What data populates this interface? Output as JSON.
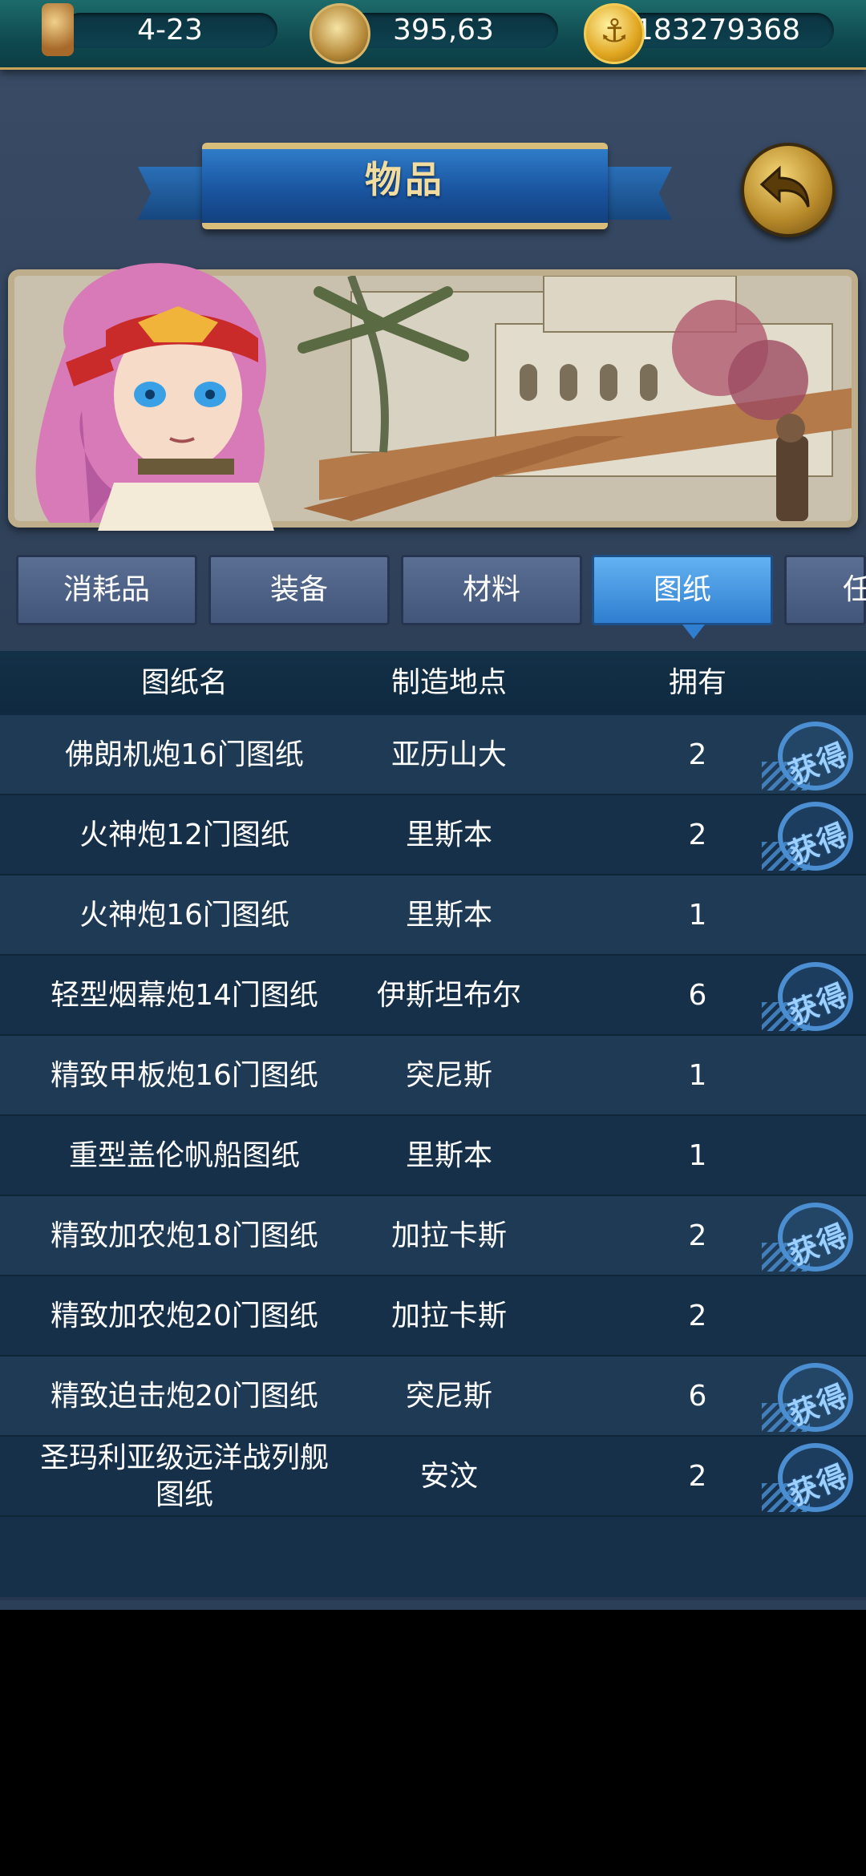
{
  "status_bar": {
    "level": "4-23",
    "compass_value": "395,63",
    "gold": "183279368"
  },
  "header": {
    "title": "物品"
  },
  "tabs": [
    {
      "label": "消耗品",
      "active": false
    },
    {
      "label": "装备",
      "active": false
    },
    {
      "label": "材料",
      "active": false
    },
    {
      "label": "图纸",
      "active": true
    },
    {
      "label": "任",
      "active": false
    }
  ],
  "table": {
    "columns": [
      "图纸名",
      "制造地点",
      "拥有"
    ],
    "rows": [
      {
        "name": "佛朗机炮16门图纸",
        "location": "亚历山大",
        "owned": "2",
        "obtain": true
      },
      {
        "name": "火神炮12门图纸",
        "location": "里斯本",
        "owned": "2",
        "obtain": true
      },
      {
        "name": "火神炮16门图纸",
        "location": "里斯本",
        "owned": "1",
        "obtain": false
      },
      {
        "name": "轻型烟幕炮14门图纸",
        "location": "伊斯坦布尔",
        "owned": "6",
        "obtain": true
      },
      {
        "name": "精致甲板炮16门图纸",
        "location": "突尼斯",
        "owned": "1",
        "obtain": false
      },
      {
        "name": "重型盖伦帆船图纸",
        "location": "里斯本",
        "owned": "1",
        "obtain": false
      },
      {
        "name": "精致加农炮18门图纸",
        "location": "加拉卡斯",
        "owned": "2",
        "obtain": true
      },
      {
        "name": "精致加农炮20门图纸",
        "location": "加拉卡斯",
        "owned": "2",
        "obtain": false
      },
      {
        "name": "精致迫击炮20门图纸",
        "location": "突尼斯",
        "owned": "6",
        "obtain": true
      },
      {
        "name": "圣玛利亚级远洋战列舰图纸",
        "location": "安汶",
        "owned": "2",
        "obtain": true
      }
    ],
    "obtain_label": "获得"
  }
}
